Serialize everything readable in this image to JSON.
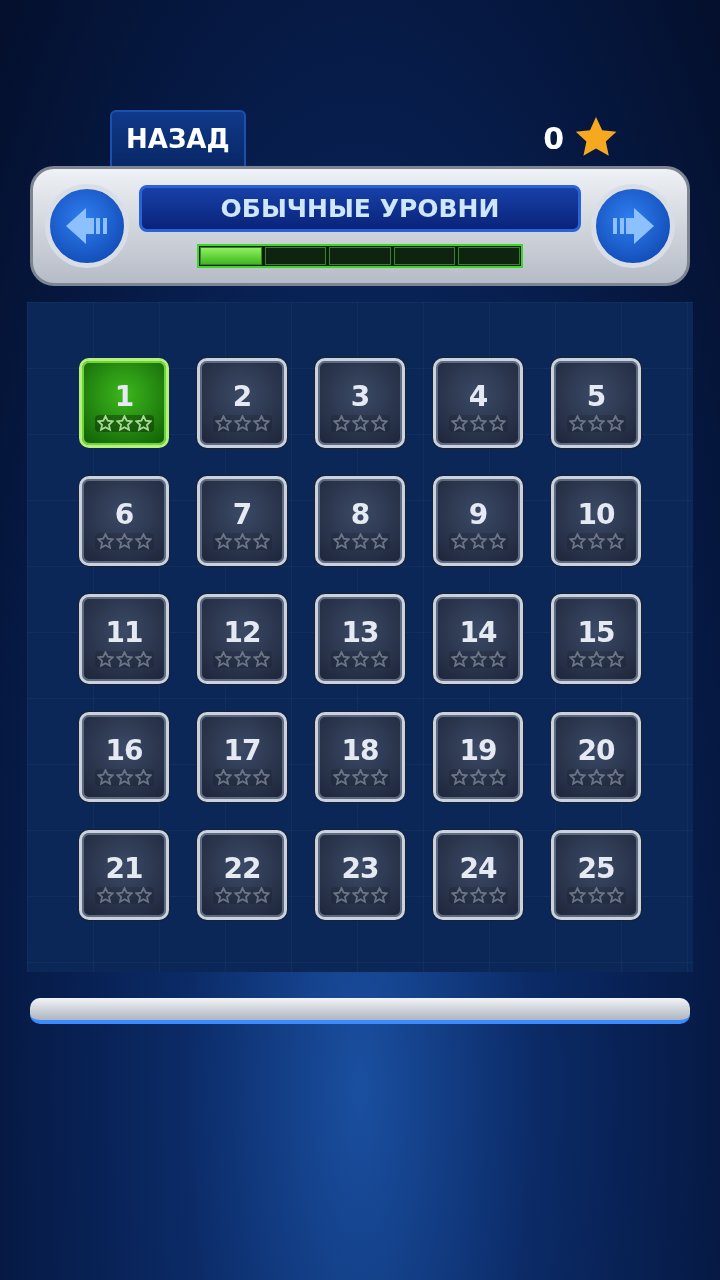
{
  "back_button": {
    "label": "НАЗАД"
  },
  "star_total": "0",
  "header": {
    "title": "ОБЫЧНЫЕ УРОВНИ",
    "level": 0.2
  },
  "levels": [
    {
      "number": "1",
      "selected": true,
      "stars": 0
    },
    {
      "number": "2",
      "selected": false,
      "stars": 0
    },
    {
      "number": "3",
      "selected": false,
      "stars": 0
    },
    {
      "number": "4",
      "selected": false,
      "stars": 0
    },
    {
      "number": "5",
      "selected": false,
      "stars": 0
    },
    {
      "number": "6",
      "selected": false,
      "stars": 0
    },
    {
      "number": "7",
      "selected": false,
      "stars": 0
    },
    {
      "number": "8",
      "selected": false,
      "stars": 0
    },
    {
      "number": "9",
      "selected": false,
      "stars": 0
    },
    {
      "number": "10",
      "selected": false,
      "stars": 0
    },
    {
      "number": "11",
      "selected": false,
      "stars": 0
    },
    {
      "number": "12",
      "selected": false,
      "stars": 0
    },
    {
      "number": "13",
      "selected": false,
      "stars": 0
    },
    {
      "number": "14",
      "selected": false,
      "stars": 0
    },
    {
      "number": "15",
      "selected": false,
      "stars": 0
    },
    {
      "number": "16",
      "selected": false,
      "stars": 0
    },
    {
      "number": "17",
      "selected": false,
      "stars": 0
    },
    {
      "number": "18",
      "selected": false,
      "stars": 0
    },
    {
      "number": "19",
      "selected": false,
      "stars": 0
    },
    {
      "number": "20",
      "selected": false,
      "stars": 0
    },
    {
      "number": "21",
      "selected": false,
      "stars": 0
    },
    {
      "number": "22",
      "selected": false,
      "stars": 0
    },
    {
      "number": "23",
      "selected": false,
      "stars": 0
    },
    {
      "number": "24",
      "selected": false,
      "stars": 0
    },
    {
      "number": "25",
      "selected": false,
      "stars": 0
    }
  ]
}
